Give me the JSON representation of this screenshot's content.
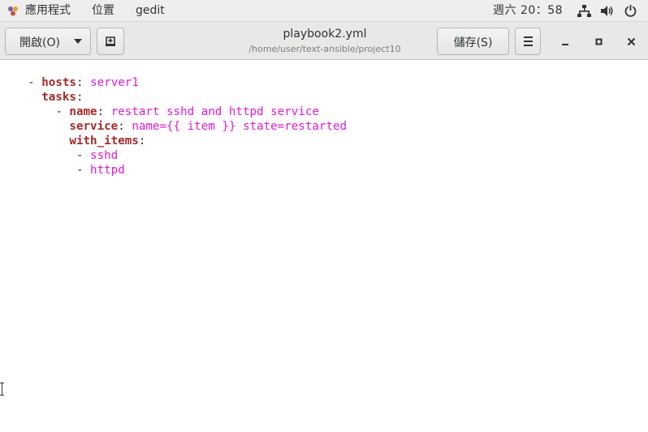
{
  "topbar": {
    "apps_label": "應用程式",
    "places_label": "位置",
    "app_name": "gedit",
    "clock": "週六 20：58",
    "icons": [
      "network-icon",
      "volume-icon",
      "power-icon"
    ]
  },
  "header": {
    "open_label": "開啟(O)",
    "title": "playbook2.yml",
    "path": "/home/user/text-ansible/project10",
    "save_label": "儲存(S)",
    "icons": [
      "new-tab-icon",
      "hamburger-menu-icon",
      "minimize-icon",
      "maximize-icon",
      "close-icon"
    ]
  },
  "editor": {
    "lines": [
      {
        "indent": "- ",
        "key": "hosts",
        "sep": ": ",
        "value": "server1"
      },
      {
        "indent": "  ",
        "key": "tasks",
        "sep": ":",
        "value": ""
      },
      {
        "indent": "    - ",
        "key": "name",
        "sep": ": ",
        "value": "restart sshd and httpd service"
      },
      {
        "indent": "      ",
        "key": "service",
        "sep": ": ",
        "value": "name={{ item }} state=restarted"
      },
      {
        "indent": "      ",
        "key": "with_items",
        "sep": ":",
        "value": ""
      },
      {
        "indent": "       - ",
        "key": "",
        "sep": "",
        "value": "sshd"
      },
      {
        "indent": "       - ",
        "key": "",
        "sep": "",
        "value": "httpd"
      }
    ]
  },
  "colors": {
    "key": "#a52a2a",
    "value": "#e01bd5",
    "topbar_bg": "#eeeeec",
    "headerbar_bg": "#e8e8e7"
  }
}
